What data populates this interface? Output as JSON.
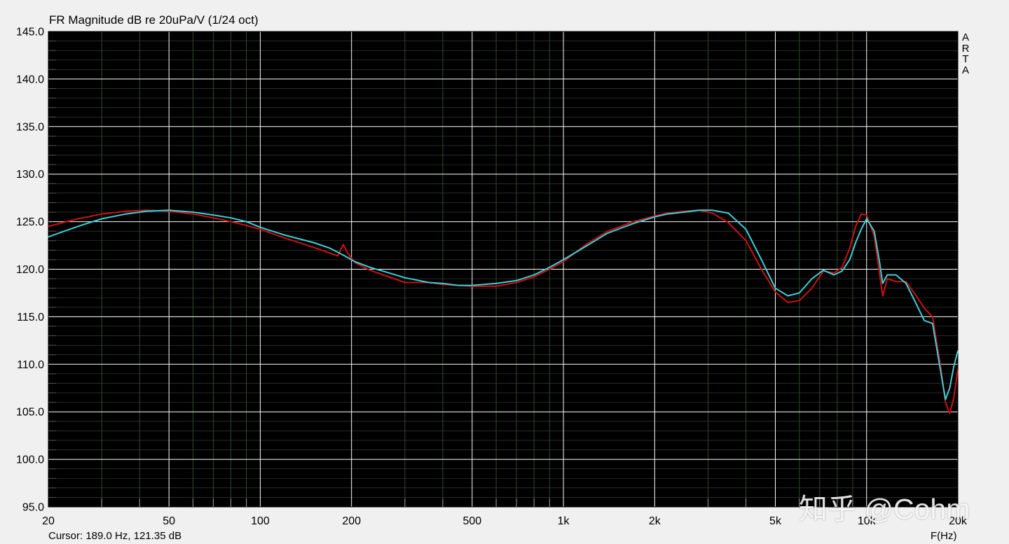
{
  "chart_data": {
    "type": "line",
    "title": "FR Magnitude dB re 20uPa/V (1/24 oct)",
    "xlabel": "F(Hz)",
    "x_scale": "log",
    "xlim": [
      20,
      20000
    ],
    "ylim": [
      95,
      145
    ],
    "grid": true,
    "x_ticks": [
      20,
      50,
      100,
      200,
      500,
      1000,
      2000,
      5000,
      10000,
      20000
    ],
    "x_tick_labels": [
      "20",
      "50",
      "100",
      "200",
      "500",
      "1k",
      "2k",
      "5k",
      "10k",
      "20k"
    ],
    "y_ticks": [
      95,
      100,
      105,
      110,
      115,
      120,
      125,
      130,
      135,
      140,
      145
    ],
    "y_tick_labels": [
      "95.0",
      "100.0",
      "105.0",
      "110.0",
      "115.0",
      "120.0",
      "125.0",
      "130.0",
      "135.0",
      "140.0",
      "145.0"
    ],
    "series": [
      {
        "color": "#cc1111",
        "x": [
          20,
          25,
          30,
          36,
          42,
          50,
          60,
          70,
          80,
          90,
          100,
          120,
          150,
          180,
          188,
          194,
          205,
          230,
          260,
          300,
          360,
          400,
          450,
          500,
          600,
          700,
          800,
          900,
          1000,
          1200,
          1400,
          1700,
          2000,
          2200,
          2500,
          2800,
          3100,
          3500,
          4000,
          4500,
          5000,
          5500,
          6000,
          6600,
          7200,
          7800,
          8300,
          8800,
          9200,
          9600,
          10000,
          10600,
          11000,
          11300,
          11700,
          12500,
          13500,
          14500,
          15500,
          16500,
          17500,
          18200,
          18800,
          19400,
          20000
        ],
        "y": [
          124.5,
          125.3,
          125.8,
          126.1,
          126.2,
          126.1,
          125.8,
          125.4,
          125.0,
          124.6,
          124.2,
          123.3,
          122.3,
          121.4,
          122.6,
          121.7,
          120.7,
          119.9,
          119.3,
          118.6,
          118.6,
          118.4,
          118.3,
          118.2,
          118.2,
          118.6,
          119.2,
          120.0,
          120.8,
          122.7,
          124.0,
          125.0,
          125.6,
          125.9,
          126.1,
          126.2,
          125.9,
          124.9,
          123.0,
          120.0,
          117.6,
          116.5,
          116.7,
          118.0,
          119.8,
          119.6,
          120.2,
          122.2,
          124.5,
          125.8,
          125.7,
          123.5,
          119.8,
          117.2,
          119.0,
          118.7,
          118.7,
          117.3,
          115.9,
          115.0,
          110.0,
          106.0,
          104.8,
          106.5,
          109.5
        ]
      },
      {
        "color": "#3ccfd6",
        "x": [
          20,
          25,
          30,
          36,
          42,
          50,
          60,
          70,
          80,
          90,
          100,
          120,
          150,
          170,
          190,
          205,
          230,
          260,
          300,
          360,
          400,
          450,
          500,
          600,
          700,
          800,
          900,
          1000,
          1200,
          1400,
          1700,
          2000,
          2200,
          2500,
          2800,
          3100,
          3500,
          4000,
          4500,
          5000,
          5500,
          6000,
          6600,
          7200,
          7800,
          8300,
          8800,
          9200,
          9600,
          10000,
          10600,
          11000,
          11300,
          11700,
          12500,
          13500,
          14500,
          15500,
          16500,
          17500,
          18200,
          18800,
          19400,
          20000
        ],
        "y": [
          123.4,
          124.5,
          125.3,
          125.8,
          126.1,
          126.2,
          126.0,
          125.7,
          125.4,
          125.0,
          124.4,
          123.6,
          122.8,
          122.2,
          121.4,
          120.8,
          120.2,
          119.7,
          119.1,
          118.6,
          118.5,
          118.3,
          118.3,
          118.5,
          118.8,
          119.4,
          120.2,
          121.0,
          122.5,
          123.8,
          124.8,
          125.5,
          125.8,
          126.0,
          126.2,
          126.2,
          125.9,
          124.2,
          121.0,
          118.0,
          117.2,
          117.5,
          119.0,
          119.9,
          119.4,
          119.8,
          121.0,
          122.8,
          124.2,
          125.3,
          124.0,
          121.0,
          118.5,
          119.4,
          119.4,
          118.5,
          116.5,
          114.6,
          114.3,
          109.5,
          106.3,
          107.5,
          109.8,
          111.4
        ]
      }
    ]
  },
  "cursor_readout": "Cursor: 189.0 Hz, 121.35 dB",
  "watermark": "知乎 @Cohm",
  "brand_mark": "ARTA",
  "colors": {
    "plot_background": "#000000",
    "frame_background": "#f0f0f0",
    "major_grid": "#ffffff",
    "minor_grid": "#2f4a2f",
    "minor_grid_y": "#7a7a7a"
  }
}
